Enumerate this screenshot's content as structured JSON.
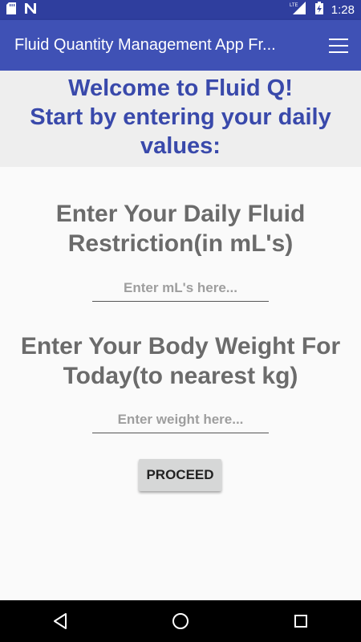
{
  "status_bar": {
    "time": "1:28",
    "network_label": "LTE",
    "battery_icon": "battery-charging-icon",
    "left_icons": [
      "sd-card-icon",
      "n-notification-icon"
    ]
  },
  "app_bar": {
    "title": "Fluid Quantity Management App Fr...",
    "menu_icon": "hamburger-menu-icon"
  },
  "welcome": {
    "text": "Welcome to Fluid Q!\n Start by entering your daily values:"
  },
  "fluid_restriction": {
    "label": "Enter Your Daily Fluid Restriction(in mL's)",
    "placeholder": "Enter mL's here...",
    "value": ""
  },
  "body_weight": {
    "label": "Enter Your Body Weight For Today(to nearest kg)",
    "placeholder": "Enter weight here...",
    "value": ""
  },
  "proceed_button": {
    "label": "PROCEED"
  },
  "nav_bar": {
    "buttons": [
      "back-icon",
      "home-icon",
      "recents-icon"
    ]
  },
  "colors": {
    "status_bar": "#2F3E9E",
    "app_bar": "#3F51B5",
    "welcome_text": "#3949AB",
    "welcome_bg": "#EEEEEE",
    "label_text": "#6B6B6B",
    "button_bg": "#D6D7D7"
  }
}
